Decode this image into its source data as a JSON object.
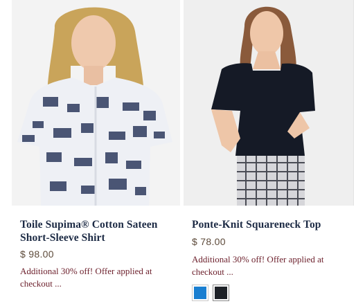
{
  "products": [
    {
      "name": "Toile Supima® Cotton Sateen Short-Sleeve Shirt",
      "price": "$ 98.00",
      "promo": "Additional 30% off! Offer applied at checkout ..."
    },
    {
      "name": "Ponte-Knit Squareneck Top",
      "price": "$ 78.00",
      "promo": "Additional 30% off! Offer applied at checkout ...",
      "swatches": [
        {
          "color": "#1a7fd1"
        },
        {
          "color": "#1e2228",
          "selected": true
        }
      ]
    }
  ]
}
